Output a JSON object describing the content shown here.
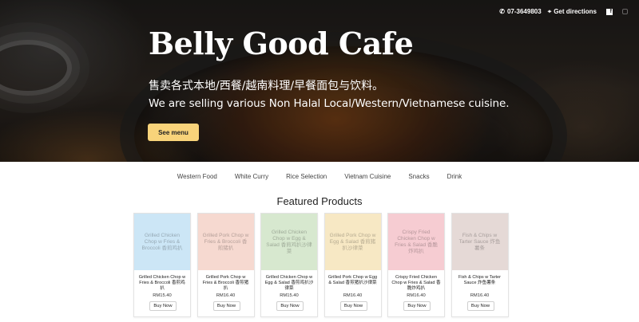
{
  "topbar": {
    "phone": "07-3649803",
    "directions": "Get directions",
    "facebook_glyph": "f",
    "icons": [
      "phone-icon",
      "map-pin-icon",
      "facebook-icon",
      "instagram-icon"
    ]
  },
  "hero": {
    "title": "Belly Good Cafe",
    "subtitle_cn": "售卖各式本地/西餐/越南料理/早餐面包与饮料。",
    "subtitle_en": "We are selling various Non Halal Local/Western/Vietnamese cuisine.",
    "cta": "See menu"
  },
  "nav": [
    "Western Food",
    "White Curry",
    "Rice Selection",
    "Vietnam Cuisine",
    "Snacks",
    "Drink"
  ],
  "featured": {
    "title": "Featured Products",
    "products": [
      {
        "image_text": "Grilled Chicken Chop w Fries & Broccoli 香煎鸡扒",
        "name": "Grilled Chicken Chop w Fries & Broccoli 香煎鸡扒",
        "price": "RM15.40",
        "button": "Buy Now",
        "color": "#cce6f6"
      },
      {
        "image_text": "Grilled Pork Chop w Fries & Broccoli 香煎猪扒",
        "name": "Grilled Pork Chop w Fries & Broccoli 香煎猪扒",
        "price": "RM16.40",
        "button": "Buy Now",
        "color": "#f6d9d0"
      },
      {
        "image_text": "Grilled Chicken Chop w Egg & Salad 香煎鸡扒沙律菜",
        "name": "Grilled Chicken Chop w Egg & Salad 香煎鸡扒沙律菜",
        "price": "RM15.40",
        "button": "Buy Now",
        "color": "#d7e8cf"
      },
      {
        "image_text": "Grilled Pork Chop w Egg & Salad 香煎猪扒沙律菜",
        "name": "Grilled Pork Chop w Egg & Salad 香煎猪扒沙律菜",
        "price": "RM16.40",
        "button": "Buy Now",
        "color": "#f7e8c4"
      },
      {
        "image_text": "Crispy Fried Chicken Chop w Fries & Salad 香脆炸鸡扒",
        "name": "Crispy Fried Chicken Chop w Fries & Salad 香脆炸鸡扒",
        "price": "RM16.40",
        "button": "Buy Now",
        "color": "#f6ccd2"
      },
      {
        "image_text": "Fish & Chips w Tarter Sauce 炸鱼薯条",
        "name": "Fish & Chips w Tarter Sauce 炸鱼薯条",
        "price": "RM16.40",
        "button": "Buy Now",
        "color": "#e5d9d6"
      }
    ]
  }
}
